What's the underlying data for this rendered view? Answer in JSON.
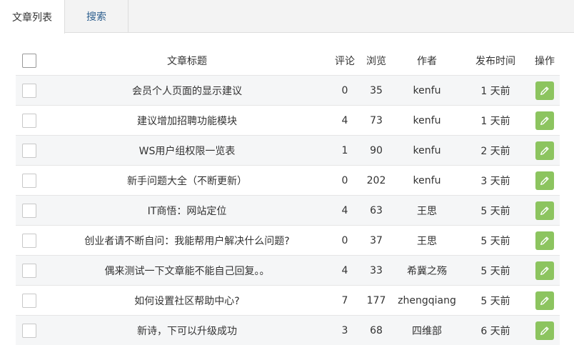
{
  "tabs": [
    {
      "label": "文章列表",
      "active": true
    },
    {
      "label": "搜索",
      "active": false
    }
  ],
  "table": {
    "columns": {
      "title": "文章标题",
      "comments": "评论",
      "views": "浏览",
      "author": "作者",
      "published": "发布时间",
      "action": "操作"
    },
    "rows": [
      {
        "title": "会员个人页面的显示建议",
        "comments": "0",
        "views": "35",
        "author": "kenfu",
        "published": "1 天前"
      },
      {
        "title": "建议增加招聘功能模块",
        "comments": "4",
        "views": "73",
        "author": "kenfu",
        "published": "1 天前"
      },
      {
        "title": "WS用户组权限一览表",
        "comments": "1",
        "views": "90",
        "author": "kenfu",
        "published": "2 天前"
      },
      {
        "title": "新手问题大全（不断更新）",
        "comments": "0",
        "views": "202",
        "author": "kenfu",
        "published": "3 天前"
      },
      {
        "title": "IT商悟：网站定位",
        "comments": "4",
        "views": "63",
        "author": "王思",
        "published": "5 天前"
      },
      {
        "title": "创业者请不断自问：我能帮用户解决什么问题?",
        "comments": "0",
        "views": "37",
        "author": "王思",
        "published": "5 天前"
      },
      {
        "title": "偶来测试一下文章能不能自己回复。。",
        "comments": "4",
        "views": "33",
        "author": "希冀之殇",
        "published": "5 天前"
      },
      {
        "title": "如何设置社区帮助中心?",
        "comments": "7",
        "views": "177",
        "author": "zhengqiang",
        "published": "5 天前"
      },
      {
        "title": "新诗，下可以升级成功",
        "comments": "3",
        "views": "68",
        "author": "四维部",
        "published": "6 天前"
      }
    ]
  },
  "colors": {
    "accent_green": "#8cc45f",
    "tab_link": "#2d5f8f",
    "stripe": "#f5f6f7"
  },
  "icons": {
    "edit": "pencil-icon"
  }
}
